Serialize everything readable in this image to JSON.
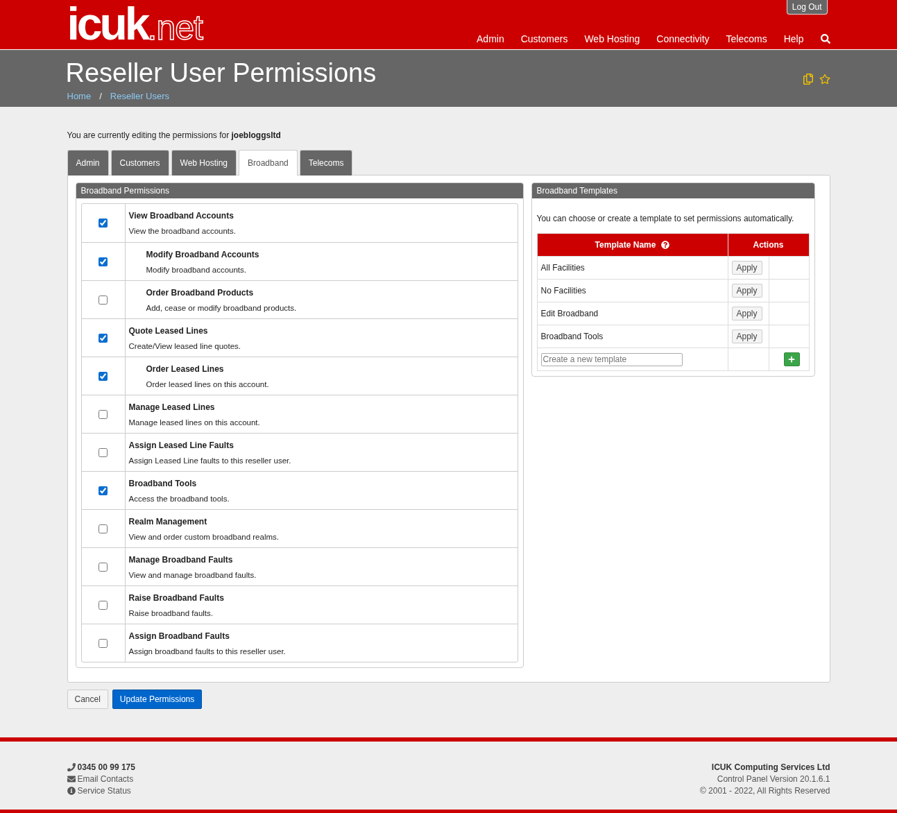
{
  "header": {
    "logo": {
      "main": "icuk",
      "suffix": ".net"
    },
    "logout": "Log Out",
    "nav": [
      "Admin",
      "Customers",
      "Web Hosting",
      "Connectivity",
      "Telecoms",
      "Help"
    ]
  },
  "title_bar": {
    "title": "Reseller User Permissions",
    "breadcrumbs": [
      "Home",
      "/",
      "Reseller Users"
    ]
  },
  "intro": "You are currently editing the permissions for **joebloggsltd**",
  "tabs": [
    {
      "label": "Admin",
      "selected": false
    },
    {
      "label": "Customers",
      "selected": false
    },
    {
      "label": "Web Hosting",
      "selected": false
    },
    {
      "label": "Broadband",
      "selected": true
    },
    {
      "label": "Telecoms",
      "selected": false
    }
  ],
  "permissions": {
    "title": "Broadband Permissions",
    "items": [
      {
        "name": "View Broadband Accounts",
        "description": "View the broadband accounts.",
        "checked": true,
        "children": [
          {
            "name": "Modify Broadband Accounts",
            "description": "Modify broadband accounts.",
            "checked": true
          },
          {
            "name": "Order Broadband Products",
            "description": "Add, cease or modify broadband products.",
            "checked": false
          }
        ]
      },
      {
        "name": "Quote Leased Lines",
        "description": "Create/View leased line quotes.",
        "checked": true,
        "children": [
          {
            "name": "Order Leased Lines",
            "description": "Order leased lines on this account.",
            "checked": true
          }
        ]
      },
      {
        "name": "Manage Leased Lines",
        "description": "Manage leased lines on this account.",
        "checked": false
      },
      {
        "name": "Assign Leased Line Faults",
        "description": "Assign Leased Line faults to this reseller user.",
        "checked": false
      },
      {
        "name": "Broadband Tools",
        "description": "Access the broadband tools.",
        "checked": true
      },
      {
        "name": "Realm Management",
        "description": "View and order custom broadband realms.",
        "checked": false
      },
      {
        "name": "Manage Broadband Faults",
        "description": "View and manage broadband faults.",
        "checked": false
      },
      {
        "name": "Raise Broadband Faults",
        "description": "Raise broadband faults.",
        "checked": false
      },
      {
        "name": "Assign Broadband Faults",
        "description": "Assign broadband faults to this reseller user.",
        "checked": false
      }
    ]
  },
  "templates": {
    "title": "Broadband Templates",
    "intro": "You can choose or create a template to set permissions automatically.",
    "columns": [
      "Template Name",
      "Actions"
    ],
    "rows": [
      {
        "name": "All Facilities",
        "action": "Apply"
      },
      {
        "name": "No Facilities",
        "action": "Apply"
      },
      {
        "name": "Edit Broadband",
        "action": "Apply"
      },
      {
        "name": "Broadband Tools",
        "action": "Apply"
      }
    ],
    "new_placeholder": "Create a new template"
  },
  "buttons": {
    "cancel": "Cancel",
    "submit": "Update Permissions"
  },
  "footer": {
    "left": [
      {
        "kind": "phone",
        "text": "0345 00 99 175"
      },
      {
        "kind": "email",
        "text": "Email Contacts"
      },
      {
        "kind": "info",
        "text": "Service Status"
      }
    ],
    "right": [
      "ICUK Computing Services Ltd",
      "Control Panel Version 20.1.6.1",
      "© 2001 - 2022, All Rights Reserved"
    ]
  }
}
